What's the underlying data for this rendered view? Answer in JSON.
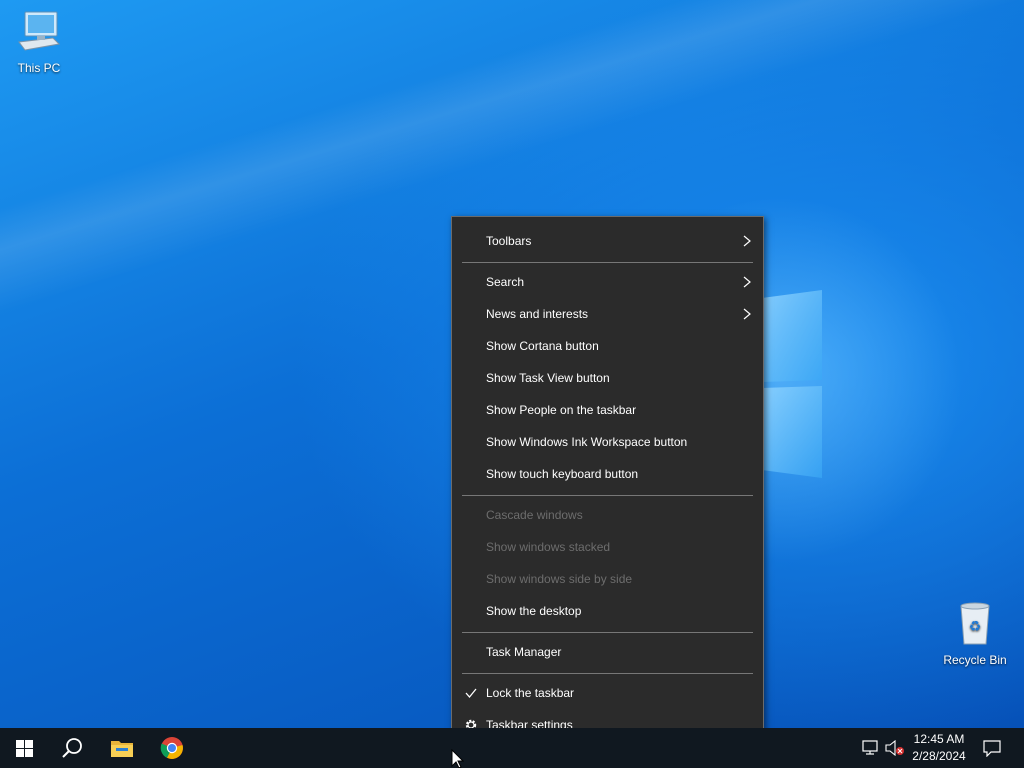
{
  "desktop": {
    "icons": [
      {
        "label": "This PC",
        "icon": "computer-icon"
      },
      {
        "label": "Recycle Bin",
        "icon": "recycle-bin-icon"
      }
    ]
  },
  "context_menu": {
    "items": [
      {
        "label": "Toolbars",
        "submenu": true,
        "enabled": true
      },
      {
        "label": "Search",
        "submenu": true,
        "enabled": true
      },
      {
        "label": "News and interests",
        "submenu": true,
        "enabled": true
      },
      {
        "label": "Show Cortana button",
        "enabled": true
      },
      {
        "label": "Show Task View button",
        "enabled": true
      },
      {
        "label": "Show People on the taskbar",
        "enabled": true
      },
      {
        "label": "Show Windows Ink Workspace button",
        "enabled": true
      },
      {
        "label": "Show touch keyboard button",
        "enabled": true
      },
      {
        "label": "Cascade windows",
        "enabled": false
      },
      {
        "label": "Show windows stacked",
        "enabled": false
      },
      {
        "label": "Show windows side by side",
        "enabled": false
      },
      {
        "label": "Show the desktop",
        "enabled": true
      },
      {
        "label": "Task Manager",
        "enabled": true
      },
      {
        "label": "Lock the taskbar",
        "checked": true,
        "enabled": true
      },
      {
        "label": "Taskbar settings",
        "icon": "gear-icon",
        "enabled": true
      }
    ]
  },
  "taskbar": {
    "pinned": [
      "start-icon",
      "search-icon",
      "file-explorer-icon",
      "chrome-icon"
    ],
    "tray": [
      "network-icon",
      "volume-muted-icon"
    ],
    "clock": {
      "time": "12:45 AM",
      "date": "2/28/2024"
    },
    "notifications_icon": "action-center-icon"
  },
  "colors": {
    "menu_bg": "#2b2b2b",
    "menu_disabled_text": "#6d6d6d",
    "taskbar_bg": "#101820",
    "desktop_accent": "#0c6fd6"
  }
}
